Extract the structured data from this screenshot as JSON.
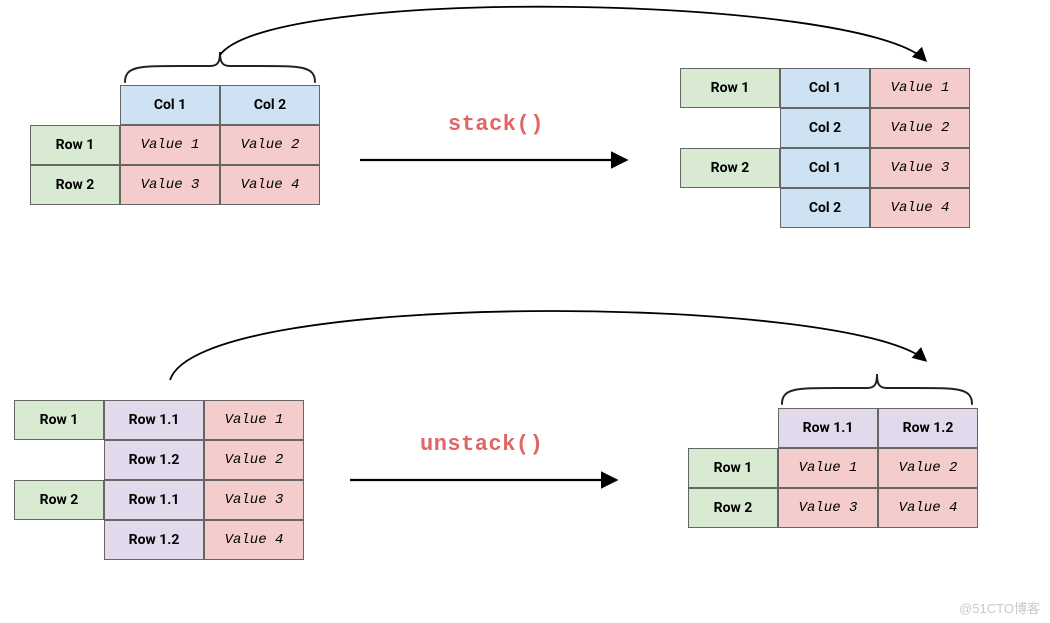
{
  "functions": {
    "stack": "stack()",
    "unstack": "unstack()"
  },
  "watermark": "@51CTO博客",
  "stack_input": {
    "col1": "Col 1",
    "col2": "Col 2",
    "row1": "Row 1",
    "row2": "Row 2",
    "v11": "Value 1",
    "v12": "Value 2",
    "v21": "Value 3",
    "v22": "Value 4"
  },
  "stack_output": {
    "row1": "Row 1",
    "row2": "Row 2",
    "c11": "Col 1",
    "c12": "Col 2",
    "c21": "Col 1",
    "c22": "Col 2",
    "v1": "Value 1",
    "v2": "Value 2",
    "v3": "Value 3",
    "v4": "Value 4"
  },
  "unstack_input": {
    "row1": "Row 1",
    "row2": "Row 2",
    "s11": "Row 1.1",
    "s12": "Row 1.2",
    "s21": "Row 1.1",
    "s22": "Row 1.2",
    "v1": "Value 1",
    "v2": "Value 2",
    "v3": "Value 3",
    "v4": "Value 4"
  },
  "unstack_output": {
    "row1": "Row 1",
    "row2": "Row 2",
    "c1": "Row 1.1",
    "c2": "Row 1.2",
    "v11": "Value 1",
    "v12": "Value 2",
    "v21": "Value 3",
    "v22": "Value 4"
  },
  "chart_data": [
    {
      "type": "table",
      "operation": "stack()",
      "before": {
        "columns": [
          "Col 1",
          "Col 2"
        ],
        "index": [
          "Row 1",
          "Row 2"
        ],
        "values": [
          [
            "Value 1",
            "Value 2"
          ],
          [
            "Value 3",
            "Value 4"
          ]
        ]
      },
      "after": {
        "index": [
          [
            "Row 1",
            "Col 1"
          ],
          [
            "Row 1",
            "Col 2"
          ],
          [
            "Row 2",
            "Col 1"
          ],
          [
            "Row 2",
            "Col 2"
          ]
        ],
        "values": [
          "Value 1",
          "Value 2",
          "Value 3",
          "Value 4"
        ]
      }
    },
    {
      "type": "table",
      "operation": "unstack()",
      "before": {
        "index": [
          [
            "Row 1",
            "Row 1.1"
          ],
          [
            "Row 1",
            "Row 1.2"
          ],
          [
            "Row 2",
            "Row 1.1"
          ],
          [
            "Row 2",
            "Row 1.2"
          ]
        ],
        "values": [
          "Value 1",
          "Value 2",
          "Value 3",
          "Value 4"
        ]
      },
      "after": {
        "columns": [
          "Row 1.1",
          "Row 1.2"
        ],
        "index": [
          "Row 1",
          "Row 2"
        ],
        "values": [
          [
            "Value 1",
            "Value 2"
          ],
          [
            "Value 3",
            "Value 4"
          ]
        ]
      }
    }
  ]
}
